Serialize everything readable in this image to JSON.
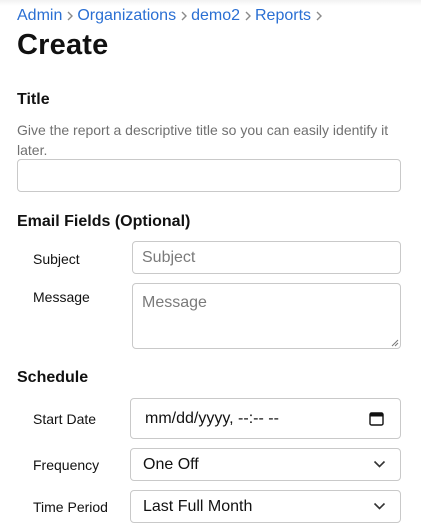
{
  "breadcrumb": [
    {
      "label": "Admin"
    },
    {
      "label": "Organizations"
    },
    {
      "label": "demo2"
    },
    {
      "label": "Reports"
    }
  ],
  "page": {
    "title": "Create"
  },
  "title_section": {
    "heading": "Title",
    "help": "Give the report a descriptive title so you can easily identify it later.",
    "value": ""
  },
  "email_section": {
    "heading": "Email Fields (Optional)",
    "subject_label": "Subject",
    "subject_placeholder": "Subject",
    "message_label": "Message",
    "message_placeholder": "Message"
  },
  "schedule_section": {
    "heading": "Schedule",
    "start_date_label": "Start Date",
    "start_date_value": "mm/dd/yyyy, --:-- --",
    "frequency_label": "Frequency",
    "frequency_value": "One Off",
    "time_period_label": "Time Period",
    "time_period_value": "Last Full Month"
  },
  "colors": {
    "link": "#2a6fd3",
    "border": "#c9c9c9",
    "muted": "#707070"
  },
  "icons": {
    "separator": "chevron-right-icon",
    "select": "chevron-down-icon",
    "date": "calendar-icon"
  }
}
